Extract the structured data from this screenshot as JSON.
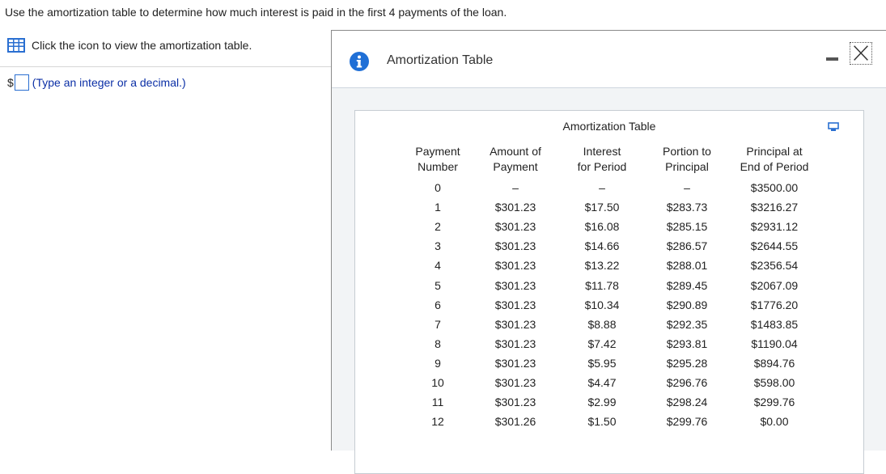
{
  "question": {
    "text": "Use the amortization table to determine how much interest is paid in the first 4 payments of the loan."
  },
  "link": {
    "label": "Click the icon to view the amortization table.",
    "icon": "table-grid-icon"
  },
  "answer": {
    "prefix": "$",
    "value": "",
    "hint": "(Type an integer or a decimal.)"
  },
  "modal": {
    "title": "Amortization Table",
    "info_icon": "info-icon",
    "minimize_icon": "minimize-icon",
    "close_icon": "close-icon"
  },
  "table": {
    "caption": "Amortization Table",
    "expand_icon": "expand-icon",
    "headers": [
      [
        "Payment",
        "Number"
      ],
      [
        "Amount of",
        "Payment"
      ],
      [
        "Interest",
        "for Period"
      ],
      [
        "Portion to",
        "Principal"
      ],
      [
        "Principal at",
        "End of Period"
      ]
    ],
    "rows": [
      [
        "0",
        "–",
        "–",
        "–",
        "$3500.00"
      ],
      [
        "1",
        "$301.23",
        "$17.50",
        "$283.73",
        "$3216.27"
      ],
      [
        "2",
        "$301.23",
        "$16.08",
        "$285.15",
        "$2931.12"
      ],
      [
        "3",
        "$301.23",
        "$14.66",
        "$286.57",
        "$2644.55"
      ],
      [
        "4",
        "$301.23",
        "$13.22",
        "$288.01",
        "$2356.54"
      ],
      [
        "5",
        "$301.23",
        "$11.78",
        "$289.45",
        "$2067.09"
      ],
      [
        "6",
        "$301.23",
        "$10.34",
        "$290.89",
        "$1776.20"
      ],
      [
        "7",
        "$301.23",
        "$8.88",
        "$292.35",
        "$1483.85"
      ],
      [
        "8",
        "$301.23",
        "$7.42",
        "$293.81",
        "$1190.04"
      ],
      [
        "9",
        "$301.23",
        "$5.95",
        "$295.28",
        "$894.76"
      ],
      [
        "10",
        "$301.23",
        "$4.47",
        "$296.76",
        "$598.00"
      ],
      [
        "11",
        "$301.23",
        "$2.99",
        "$298.24",
        "$299.76"
      ],
      [
        "12",
        "$301.26",
        "$1.50",
        "$299.76",
        "$0.00"
      ]
    ]
  },
  "colors": {
    "accent_blue": "#2a6fd1",
    "hint_blue": "#0b2fa6",
    "panel_bg": "#f2f4f6"
  }
}
